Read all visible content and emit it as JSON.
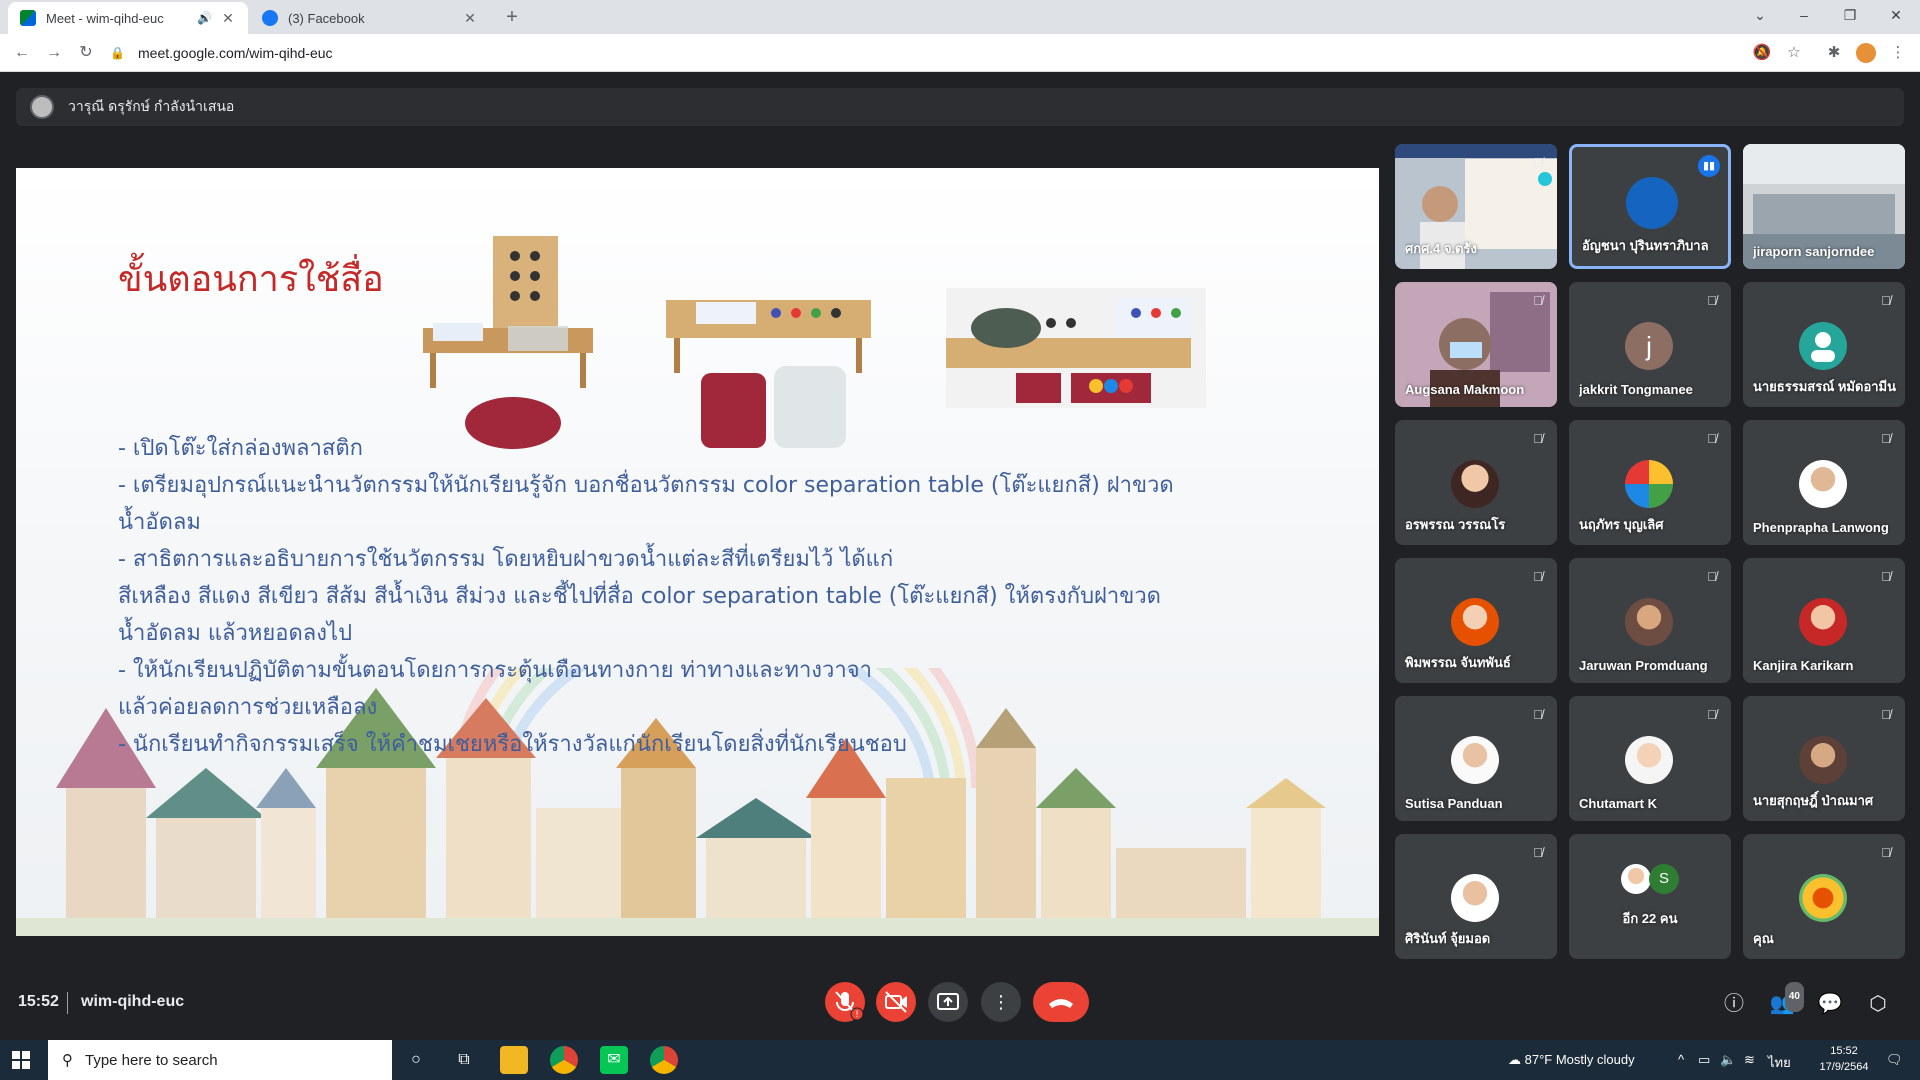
{
  "browser": {
    "tabs": [
      {
        "title": "Meet - wim-qihd-euc",
        "active": true
      },
      {
        "title": "(3) Facebook",
        "active": false
      }
    ],
    "url": "meet.google.com/wim-qihd-euc"
  },
  "meet": {
    "presenter": "วารุณี ดรุรักษ์ กำลังนำเสนอ",
    "slide": {
      "title": "ขั้นตอนการใช้สื่อ",
      "lines": [
        "- เปิดโต๊ะใส่กล่องพลาสติก",
        "- เตรียมอุปกรณ์แนะนำนวัตกรรมให้นักเรียนรู้จัก บอกชื่อนวัตกรรม color separation table (โต๊ะแยกสี) ฝาขวด",
        "น้ำอัดลม",
        "- สาธิตการและอธิบายการใช้นวัตกรรม โดยหยิบฝาขวดน้ำแต่ละสีที่เตรียมไว้ ได้แก่",
        "สีเหลือง สีแดง สีเขียว สีส้ม สีน้ำเงิน สีม่วง และชี้ไปที่สื่อ color separation table   (โต๊ะแยกสี) ให้ตรงกับฝาขวด",
        "น้ำอัดลม แล้วหยอดลงไป",
        "- ให้นักเรียนปฏิบัติตามขั้นตอนโดยการกระตุ้นเตือนทางกาย ท่าทางและทางวาจา",
        "แล้วค่อยลดการช่วยเหลือลง",
        "- นักเรียนทำกิจกรรมเสร็จ ให้คำชมเชยหรือให้รางวัลแก่นักเรียนโดยสิ่งที่นักเรียนชอบ"
      ]
    },
    "participants": [
      {
        "name": "ศกศ.4 จ.ตรัง",
        "type": "video"
      },
      {
        "name": "อัญชนา ปุรินทราภิบาล",
        "type": "avatar",
        "speaking": true
      },
      {
        "name": "jiraporn sanjorndee",
        "type": "video"
      },
      {
        "name": "Augsana Makmoon",
        "type": "video"
      },
      {
        "name": "jakkrit Tongmanee",
        "type": "letter",
        "letter": "j",
        "color": "#8d6e63"
      },
      {
        "name": "นายธรรมสรณ์ หมัดอามีน",
        "type": "letter",
        "letter": "",
        "color": "#26a69a"
      },
      {
        "name": "อรพรรณ วรรณโร",
        "type": "avatar"
      },
      {
        "name": "นฤภัทร บุญเลิศ",
        "type": "avatar"
      },
      {
        "name": "Phenprapha Lanwong",
        "type": "avatar"
      },
      {
        "name": "พิมพรรณ จันทพันธ์",
        "type": "avatar"
      },
      {
        "name": "Jaruwan Promduang",
        "type": "avatar"
      },
      {
        "name": "Kanjira Karikarn",
        "type": "avatar"
      },
      {
        "name": "Sutisa Panduan",
        "type": "avatar"
      },
      {
        "name": "Chutamart K",
        "type": "avatar"
      },
      {
        "name": "นายสุกฤษฎิ์ ป่าณมาศ",
        "type": "avatar"
      },
      {
        "name": "ศิรินันท์ จุ้ยมอด",
        "type": "avatar"
      },
      {
        "name": "อีก 22 คน",
        "type": "more",
        "letter": "S"
      },
      {
        "name": "คุณ",
        "type": "avatar"
      }
    ],
    "meeting_time": "15:52",
    "meeting_code": "wim-qihd-euc",
    "people_count": "40"
  },
  "taskbar": {
    "search_placeholder": "Type here to search",
    "weather": "87°F  Mostly cloudy",
    "lang": "ไทย",
    "time": "15:52",
    "date": "17/9/2564"
  },
  "colors": {
    "meet_bg": "#202124",
    "end_call": "#ea4335",
    "slide_title": "#c62828",
    "slide_text": "#3f5e9c",
    "speaking_border": "#8ab4f8"
  }
}
